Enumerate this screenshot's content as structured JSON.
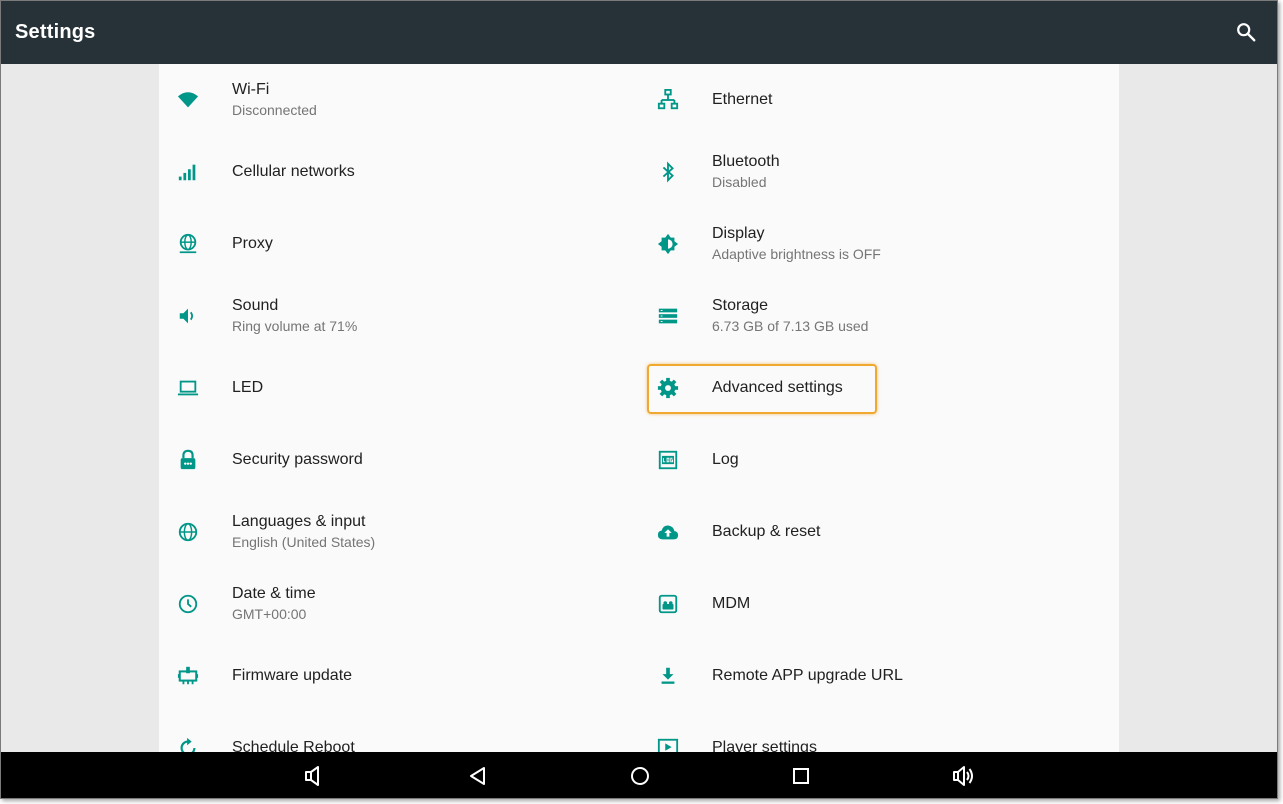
{
  "header": {
    "title": "Settings",
    "search_icon": "search-icon"
  },
  "colors": {
    "appbar": "#263238",
    "accent": "#009688",
    "highlight": "#f0a830"
  },
  "settings": {
    "left": [
      {
        "label": "Wi-Fi",
        "sub": "Disconnected",
        "icon": "wifi-icon"
      },
      {
        "label": "Cellular networks",
        "sub": "",
        "icon": "signal-icon"
      },
      {
        "label": "Proxy",
        "sub": "",
        "icon": "proxy-icon"
      },
      {
        "label": "Sound",
        "sub": "Ring volume at 71%",
        "icon": "volume-icon"
      },
      {
        "label": "LED",
        "sub": "",
        "icon": "laptop-icon"
      },
      {
        "label": "Security password",
        "sub": "",
        "icon": "lock-icon"
      },
      {
        "label": "Languages & input",
        "sub": "English (United States)",
        "icon": "globe-icon"
      },
      {
        "label": "Date & time",
        "sub": "GMT+00:00",
        "icon": "clock-icon"
      },
      {
        "label": "Firmware update",
        "sub": "",
        "icon": "chip-icon"
      },
      {
        "label": "Schedule Reboot",
        "sub": "",
        "icon": "reboot-icon"
      }
    ],
    "right": [
      {
        "label": "Ethernet",
        "sub": "",
        "icon": "ethernet-icon"
      },
      {
        "label": "Bluetooth",
        "sub": "Disabled",
        "icon": "bluetooth-icon"
      },
      {
        "label": "Display",
        "sub": "Adaptive brightness is OFF",
        "icon": "brightness-icon"
      },
      {
        "label": "Storage",
        "sub": "6.73 GB of 7.13 GB used",
        "icon": "storage-icon"
      },
      {
        "label": "Advanced settings",
        "sub": "",
        "icon": "gear-icon"
      },
      {
        "label": "Log",
        "sub": "",
        "icon": "log-icon"
      },
      {
        "label": "Backup & reset",
        "sub": "",
        "icon": "cloud-upload-icon"
      },
      {
        "label": "MDM",
        "sub": "",
        "icon": "mdm-icon"
      },
      {
        "label": "Remote APP upgrade URL",
        "sub": "",
        "icon": "download-icon"
      },
      {
        "label": "Player settings",
        "sub": "",
        "icon": "play-icon"
      }
    ]
  },
  "navbar": {
    "buttons": [
      "volume-down-icon",
      "back-icon",
      "home-icon",
      "recents-icon",
      "volume-up-icon"
    ]
  }
}
